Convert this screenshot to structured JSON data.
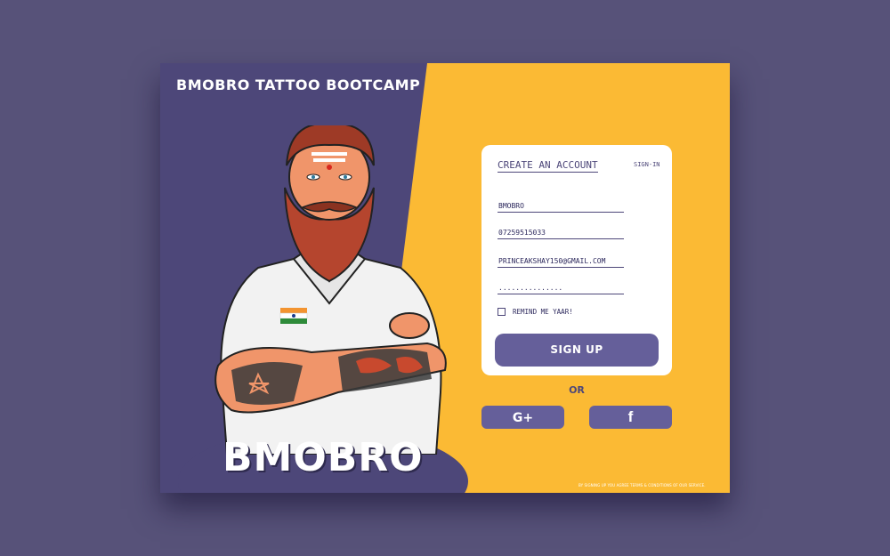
{
  "app": {
    "title": "BMOBRO TATTOO BOOTCAMP",
    "brand": "BMOBRO"
  },
  "colors": {
    "background": "#575279",
    "panel_purple": "#4d4779",
    "accent_yellow": "#fbba34",
    "button_purple": "#655f9a"
  },
  "form": {
    "tab_create": "CREATE AN ACCOUNT",
    "tab_signin": "SIGN-IN",
    "fields": {
      "username": "BMOBRO",
      "phone": "07259515033",
      "email": "PRINCEAKSHAY150@GMAIL.COM",
      "password": "..............."
    },
    "remember_label": "REMIND ME YAAR!",
    "remember_checked": false,
    "submit_label": "SIGN UP"
  },
  "social": {
    "or_label": "OR",
    "google_label": "G+",
    "google_icon": "google-plus-icon",
    "facebook_label": "f",
    "facebook_icon": "facebook-icon"
  },
  "footer": {
    "terms_text": "BY SIGNING UP YOU AGREE    TERMS & CONDITIONS OF OUR SERVICE."
  }
}
